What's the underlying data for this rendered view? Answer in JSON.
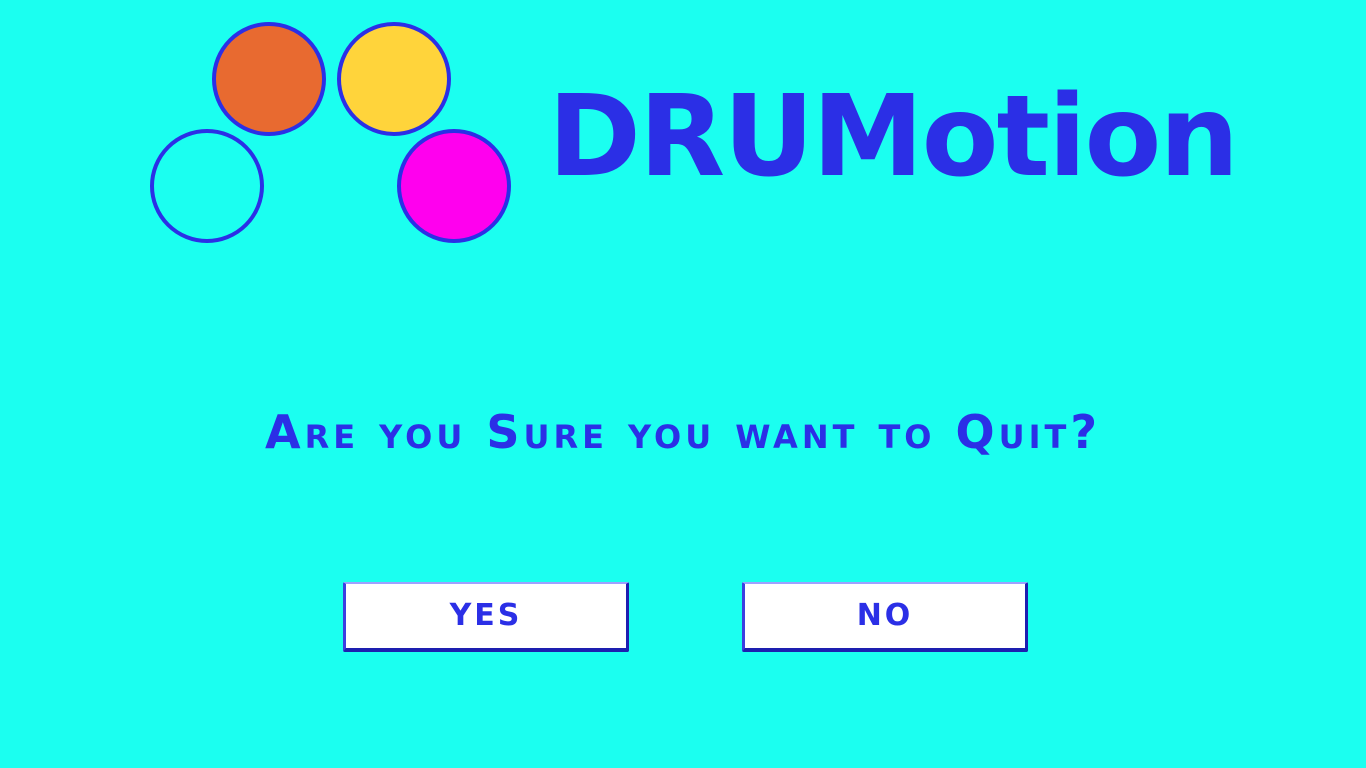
{
  "logo": {
    "brand_name": "DRUMotion",
    "circles": [
      {
        "name": "orange",
        "fill": "#e86a30"
      },
      {
        "name": "yellow",
        "fill": "#ffd43b"
      },
      {
        "name": "outline",
        "fill": "transparent"
      },
      {
        "name": "magenta",
        "fill": "#ff00ee"
      }
    ]
  },
  "dialog": {
    "question": "Are you Sure you want to Quit?",
    "yes_label": "YES",
    "no_label": "NO"
  },
  "colors": {
    "background": "#1bfff0",
    "accent": "#2b2fe6",
    "button_bg": "#ffffff"
  }
}
